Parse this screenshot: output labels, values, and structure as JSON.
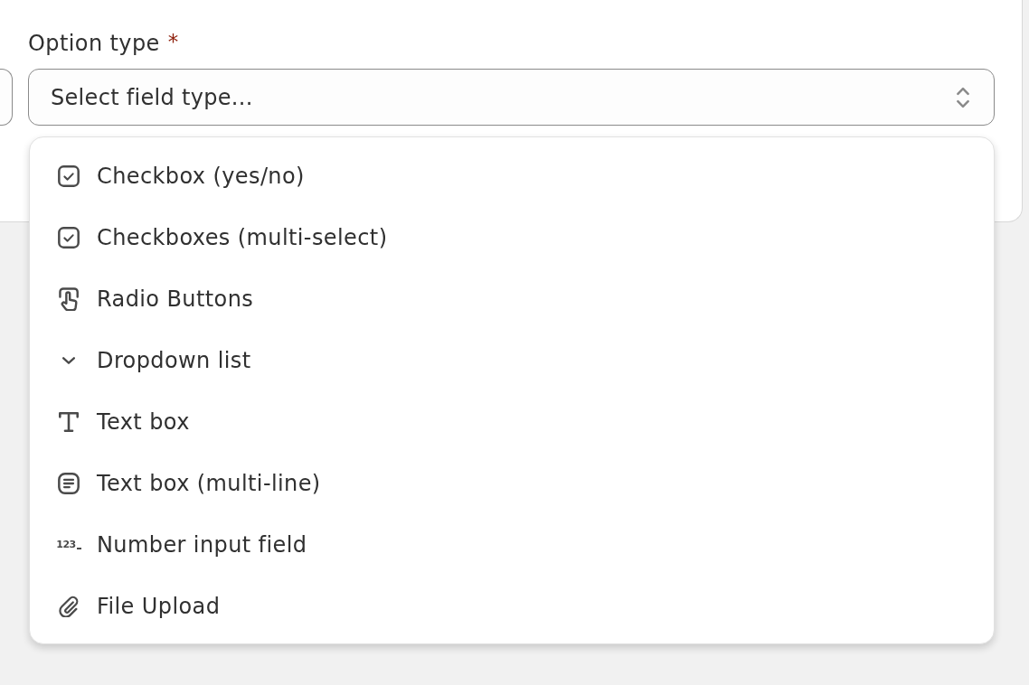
{
  "form": {
    "label": {
      "text": "Option type",
      "required_mark": "*"
    },
    "select": {
      "placeholder": "Select field type...",
      "expanded": true
    },
    "menu": {
      "items": [
        {
          "kind": "checkbox",
          "label": "Checkbox (yes/no)",
          "selected": false
        },
        {
          "kind": "checkbox",
          "label": "Checkboxes (multi-select)",
          "selected": false
        },
        {
          "kind": "hand",
          "label": "Radio Buttons",
          "selected": false
        },
        {
          "kind": "chevron",
          "label": "Dropdown list",
          "selected": false
        },
        {
          "kind": "text",
          "label": "Text box",
          "selected": false
        },
        {
          "kind": "lines",
          "label": "Text box (multi-line)",
          "selected": false
        },
        {
          "kind": "number",
          "label": "Number input field",
          "glyph": "123",
          "selected": false
        },
        {
          "kind": "paperclip",
          "label": "File Upload",
          "selected": false
        }
      ]
    }
  }
}
